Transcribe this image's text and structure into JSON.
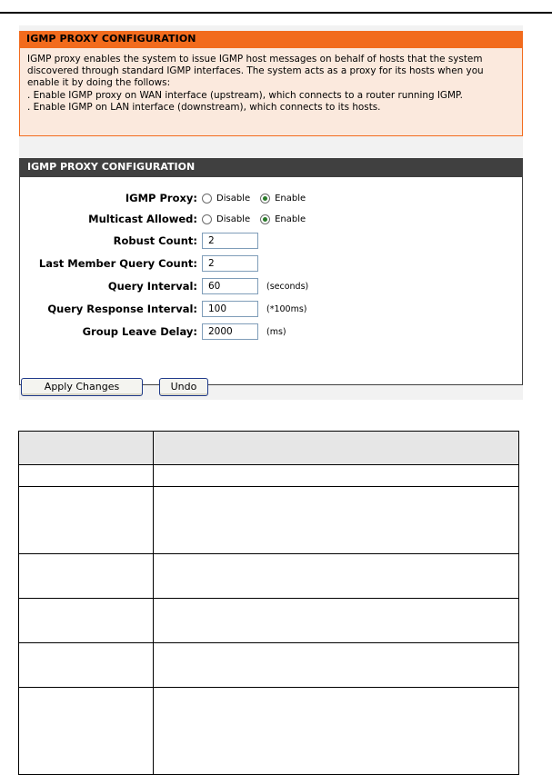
{
  "info": {
    "title": "IGMP PROXY CONFIGURATION",
    "lines": [
      "IGMP proxy enables the system to issue IGMP host messages on behalf of hosts that the system",
      "discovered through standard IGMP interfaces. The system acts as a proxy for its hosts when you",
      "enable it by doing the follows:",
      ". Enable IGMP proxy on WAN interface (upstream), which connects to a router running IGMP.",
      ". Enable IGMP on LAN interface (downstream), which connects to its hosts."
    ]
  },
  "config": {
    "title": "IGMP PROXY CONFIGURATION",
    "igmp_proxy": {
      "label": "IGMP Proxy:",
      "disable": "Disable",
      "enable": "Enable",
      "selected": "Enable"
    },
    "multicast": {
      "label": "Multicast Allowed:",
      "disable": "Disable",
      "enable": "Enable",
      "selected": "Enable"
    },
    "robust_count": {
      "label": "Robust Count:",
      "value": "2"
    },
    "last_member": {
      "label": "Last Member Query Count:",
      "value": "2"
    },
    "query_interval": {
      "label": "Query Interval:",
      "value": "60",
      "unit": "(seconds)"
    },
    "query_response": {
      "label": "Query Response Interval:",
      "value": "100",
      "unit": "(*100ms)"
    },
    "group_leave": {
      "label": "Group Leave Delay:",
      "value": "2000",
      "unit": "(ms)"
    }
  },
  "buttons": {
    "apply": "Apply Changes",
    "undo": "Undo"
  },
  "colors": {
    "info_header": "#f26b1d",
    "info_body": "#fbe9dd",
    "config_header": "#404040"
  }
}
